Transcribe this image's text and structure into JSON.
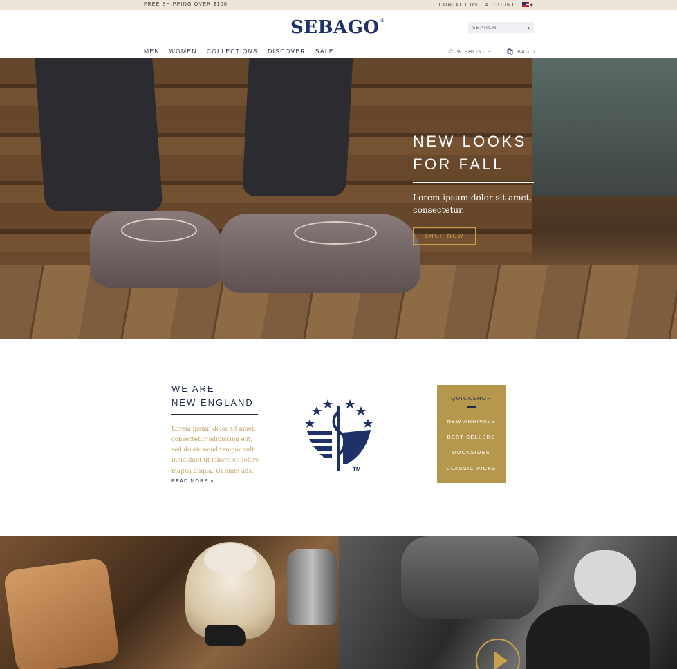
{
  "topbar": {
    "shipping": "FREE SHIPPING OVER $100",
    "contact": "CONTACT US",
    "account": "ACCOUNT"
  },
  "header": {
    "logo": "SEBAGO",
    "search_placeholder": "SEARCH",
    "nav": [
      "MEN",
      "WOMEN",
      "COLLECTIONS",
      "DISCOVER",
      "SALE"
    ],
    "wishlist_label": "WISHLIST",
    "wishlist_count": "3",
    "bag_label": "BAG",
    "bag_count": "0"
  },
  "hero": {
    "title_line1": "NEW LOOKS",
    "title_line2": "FOR FALL",
    "text": "Lorem ipsum dolor sit amet, consectetur.",
    "cta": "SHOP NOW"
  },
  "about": {
    "title_line1": "WE ARE",
    "title_line2": "NEW ENGLAND",
    "body": "Lorem ipsum dolor sit amet, consectetur adipiscing elit, sed do eiusmod tempor sult incididunt ut labore et dolore magna aliqua. Ut enim ads.",
    "read_more": "READ MORE »"
  },
  "emblem": {
    "trademark": "TM"
  },
  "quickshop": {
    "title": "QUICKSHOP",
    "links": [
      "NEW ARRIVALS",
      "BEST SELLERS",
      "DOCKSIDES",
      "CLASSIC PICKS"
    ]
  },
  "colors": {
    "navy": "#1e3168",
    "gold": "#b6974e",
    "topbar": "#ede6d8"
  },
  "icons": [
    "star-icon",
    "bag-icon",
    "chevron-right-icon",
    "chevron-down-icon",
    "us-flag-icon",
    "play-icon"
  ]
}
